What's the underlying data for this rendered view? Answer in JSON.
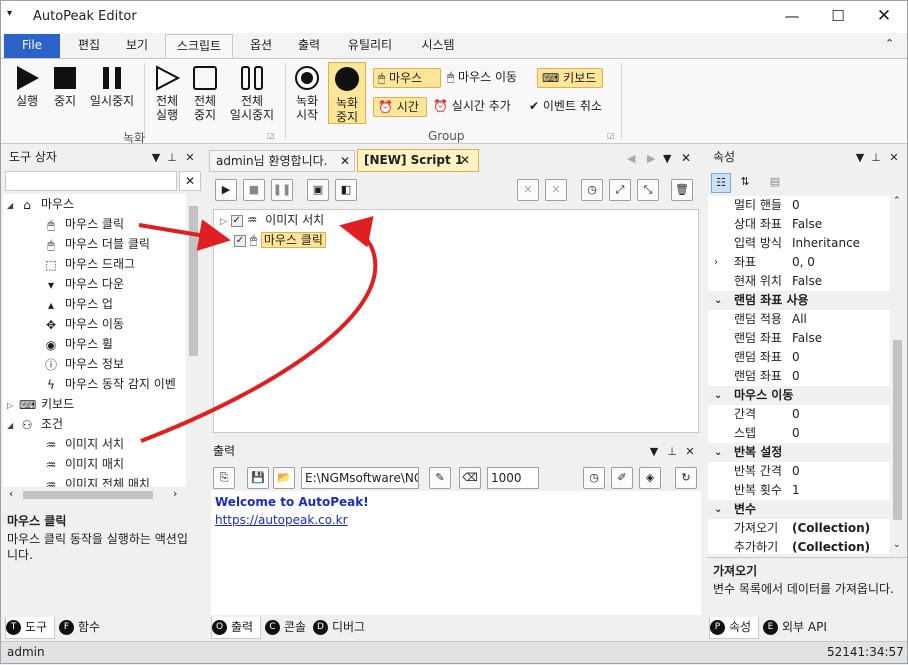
{
  "app": {
    "title": "AutoPeak Editor"
  },
  "menu_tabs": {
    "file": "File",
    "edit": "편집",
    "view": "보기",
    "script": "스크립트",
    "options": "옵션",
    "output": "출력",
    "utility": "유틸리티",
    "system": "시스템"
  },
  "ribbon": {
    "run": "실행",
    "stop": "중지",
    "pause": "일시중지",
    "run_all": "전체\n실행",
    "stop_all": "전체\n중지",
    "pause_all": "전체\n일시중지",
    "rec_start": "녹화\n시작",
    "rec_stop": "녹화\n중지",
    "mouse_click": "마우스",
    "mouse_move": "마우스 이동",
    "keyboard": "키보드",
    "time": "시간",
    "realtime_add": "실시간 추가",
    "event_cancel": "이벤트 취소",
    "group_record": "녹화",
    "group_group": "Group"
  },
  "toolbox": {
    "title": "도구 상자",
    "items": [
      {
        "label": "마우스",
        "icon": "mouse-icon"
      },
      {
        "label": "마우스 클릭",
        "icon": "mouse-click-icon"
      },
      {
        "label": "마우스 더블 클릭",
        "icon": "mouse-double-click-icon"
      },
      {
        "label": "마우스 드래그",
        "icon": "mouse-drag-icon"
      },
      {
        "label": "마우스 다운",
        "icon": "mouse-down-icon"
      },
      {
        "label": "마우스 업",
        "icon": "mouse-up-icon"
      },
      {
        "label": "마우스 이동",
        "icon": "move-icon"
      },
      {
        "label": "마우스 휠",
        "icon": "mouse-wheel-icon"
      },
      {
        "label": "마우스 정보",
        "icon": "info-icon"
      },
      {
        "label": "마우스 동작 감지 이벤",
        "icon": "lightning-icon"
      },
      {
        "label": "키보드",
        "icon": "keyboard-icon"
      },
      {
        "label": "조건",
        "icon": "condition-icon"
      },
      {
        "label": "이미지 서치",
        "icon": "image-search-icon"
      },
      {
        "label": "이미지 매치",
        "icon": "image-match-icon"
      },
      {
        "label": "이미지 전체 매치",
        "icon": "image-match-all-icon"
      }
    ],
    "desc_title": "마우스 클릭",
    "desc_text": "마우스 클릭 동작을 실행하는 액션입니다.",
    "tab_tools": "도구",
    "tab_functions": "함수"
  },
  "doc_tabs": {
    "welcome": "admin님 환영합니다.",
    "script": "[NEW] Script 1"
  },
  "script_tree": {
    "item1": "이미지 서치",
    "item2": "마우스 클릭"
  },
  "output": {
    "title": "출력",
    "path": "E:\\NGMsoftware\\NG",
    "delay": "1000",
    "line1": "Welcome to AutoPeak!",
    "line2": "https://autopeak.co.kr",
    "tab_output": "출력",
    "tab_console": "콘솔",
    "tab_debug": "디버그"
  },
  "properties": {
    "title": "속성",
    "rows": [
      {
        "name": "멀티 핸들",
        "value": "0",
        "type": "row"
      },
      {
        "name": "상대 좌표",
        "value": "False",
        "type": "row"
      },
      {
        "name": "입력 방식",
        "value": "Inheritance",
        "type": "row"
      },
      {
        "name": "좌표",
        "value": "0, 0",
        "type": "expand"
      },
      {
        "name": "현재 위치",
        "value": "False",
        "type": "row"
      },
      {
        "name": "랜덤 좌표 사용",
        "value": "",
        "type": "cat"
      },
      {
        "name": "랜덤 적용",
        "value": "All",
        "type": "row"
      },
      {
        "name": "랜덤 좌표",
        "value": "False",
        "type": "row"
      },
      {
        "name": "랜덤 좌표",
        "value": "0",
        "type": "row"
      },
      {
        "name": "랜덤 좌표",
        "value": "0",
        "type": "row"
      },
      {
        "name": "마우스 이동",
        "value": "",
        "type": "cat"
      },
      {
        "name": "간격",
        "value": "0",
        "type": "row"
      },
      {
        "name": "스텝",
        "value": "0",
        "type": "row"
      },
      {
        "name": "반복 설정",
        "value": "",
        "type": "cat"
      },
      {
        "name": "반복 간격",
        "value": "0",
        "type": "row"
      },
      {
        "name": "반복 횟수",
        "value": "1",
        "type": "row"
      },
      {
        "name": "변수",
        "value": "",
        "type": "cat"
      },
      {
        "name": "가져오기",
        "value": "(Collection)",
        "type": "row"
      },
      {
        "name": "추가하기",
        "value": "(Collection)",
        "type": "row"
      }
    ],
    "desc_title": "가져오기",
    "desc_text": "변수 목록에서 데이터를 가져옵니다.",
    "tab_props": "속성",
    "tab_api": "외부 API"
  },
  "status": {
    "user": "admin",
    "time": "52141:34:57"
  }
}
